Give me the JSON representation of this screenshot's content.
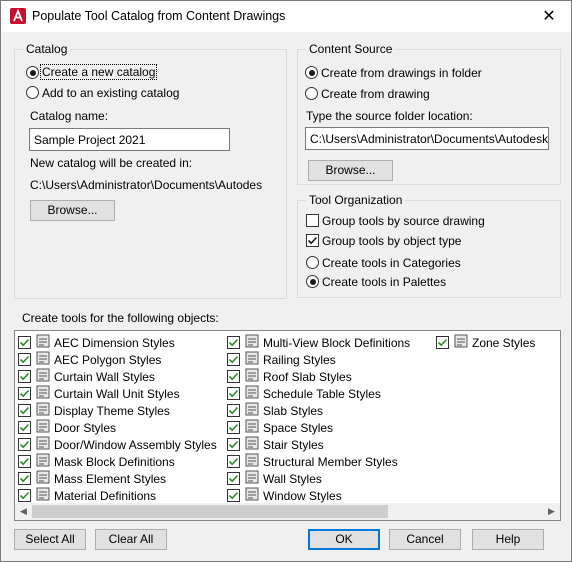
{
  "window": {
    "title": "Populate Tool Catalog from Content Drawings",
    "close_glyph": "✕",
    "app_icon": "autocad-a-icon"
  },
  "catalog": {
    "legend": "Catalog",
    "option_new": "Create a new catalog",
    "option_existing": "Add to an existing catalog",
    "name_label": "Catalog name:",
    "name_value": "Sample Project 2021",
    "location_label": "New catalog will be created in:",
    "location_value": "C:\\Users\\Administrator\\Documents\\Autodesk\\M",
    "browse_label": "Browse..."
  },
  "content_source": {
    "legend": "Content Source",
    "option_folder": "Create from drawings in folder",
    "option_drawing": "Create from drawing",
    "folder_label": "Type the source folder location:",
    "folder_value": "C:\\Users\\Administrator\\Documents\\Autodesk\\My",
    "browse_label": "Browse..."
  },
  "tool_organization": {
    "legend": "Tool Organization",
    "group_source": "Group tools by source drawing",
    "group_type": "Group tools by object type",
    "create_categories": "Create tools in Categories",
    "create_palettes": "Create tools in Palettes"
  },
  "objects": {
    "label": "Create tools for the following objects:",
    "col1": [
      "AEC Dimension Styles",
      "AEC Polygon Styles",
      "Curtain Wall Styles",
      "Curtain Wall Unit Styles",
      "Display Theme Styles",
      "Door Styles",
      "Door/Window Assembly Styles",
      "Mask Block Definitions",
      "Mass Element Styles",
      "Material Definitions"
    ],
    "col2": [
      "Multi-View Block Definitions",
      "Railing Styles",
      "Roof Slab Styles",
      "Schedule Table Styles",
      "Slab Styles",
      "Space Styles",
      "Stair Styles",
      "Structural Member Styles",
      "Wall Styles",
      "Window Styles"
    ],
    "col3": [
      "Zone Styles"
    ],
    "scroll_left": "◀",
    "scroll_right": "▶"
  },
  "buttons": {
    "select_all": "Select All",
    "clear_all": "Clear All",
    "ok": "OK",
    "cancel": "Cancel",
    "help": "Help"
  },
  "colors": {
    "accent": "#0078d7",
    "check": "#1a1a1a"
  }
}
